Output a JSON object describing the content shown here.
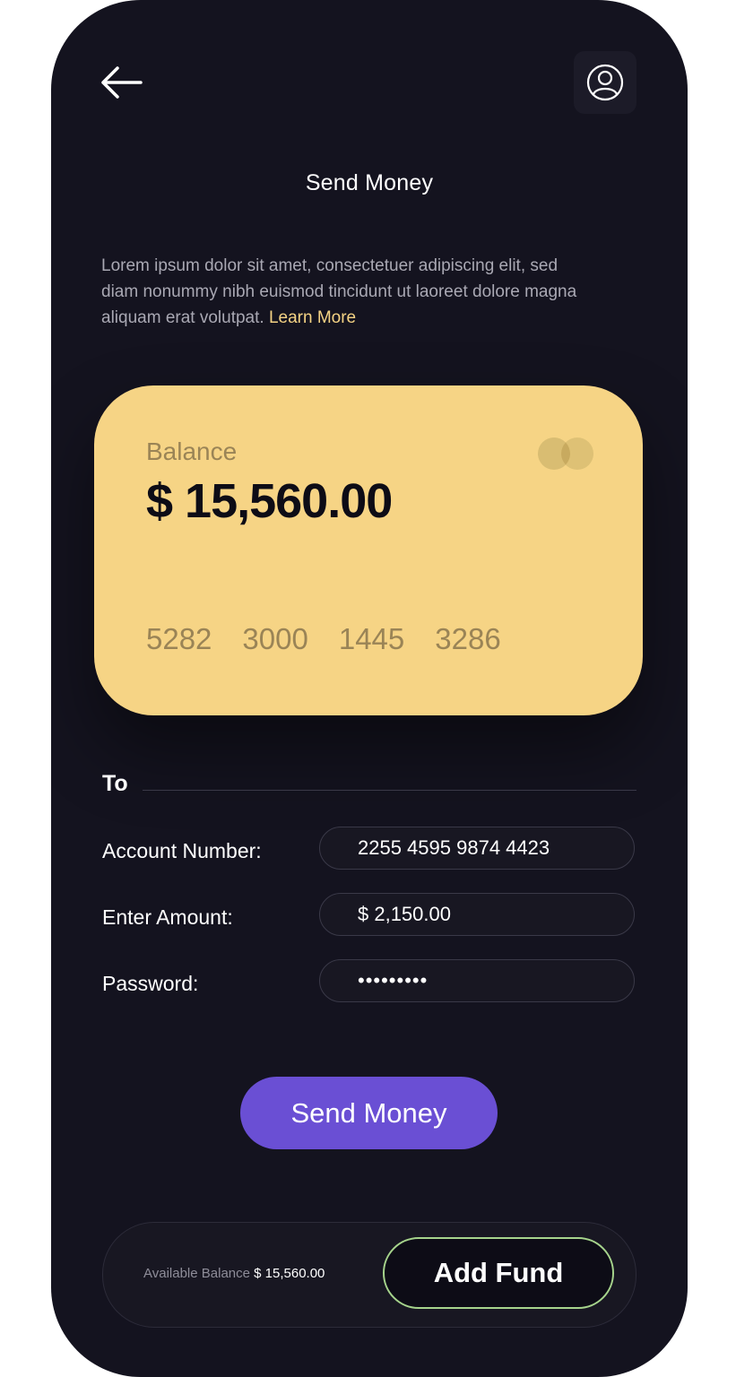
{
  "header": {
    "back_icon": "arrow-left-icon",
    "profile_icon": "user-circle-icon",
    "title": "Send Money"
  },
  "intro": {
    "text": "Lorem ipsum dolor sit amet, consectetuer adipiscing elit, sed diam nonummy nibh euismod tincidunt ut laoreet dolore magna aliquam erat volutpat.",
    "link_label": "Learn More"
  },
  "card": {
    "balance_label": "Balance",
    "balance_value": "$ 15,560.00",
    "logo_icon": "mastercard-logo-icon",
    "number_groups": [
      "5282",
      "3000",
      "1445",
      "3286"
    ],
    "color": "#f6d485"
  },
  "form": {
    "section_label": "To",
    "fields": [
      {
        "label": "Account Number:",
        "value": "2255 4595 9874 4423"
      },
      {
        "label": "Enter Amount:",
        "value": "$ 2,150.00"
      },
      {
        "label": "Password:",
        "value": "•••••••••"
      }
    ]
  },
  "send_button": {
    "label": "Send Money",
    "color": "#6a4fd4"
  },
  "footer": {
    "available_label": "Available Balance",
    "available_amount": "$ 15,560.00",
    "add_fund_label": "Add Fund",
    "add_fund_border": "#a6d48c"
  },
  "colors": {
    "background": "#14131f",
    "accent_link": "#f5d384"
  }
}
